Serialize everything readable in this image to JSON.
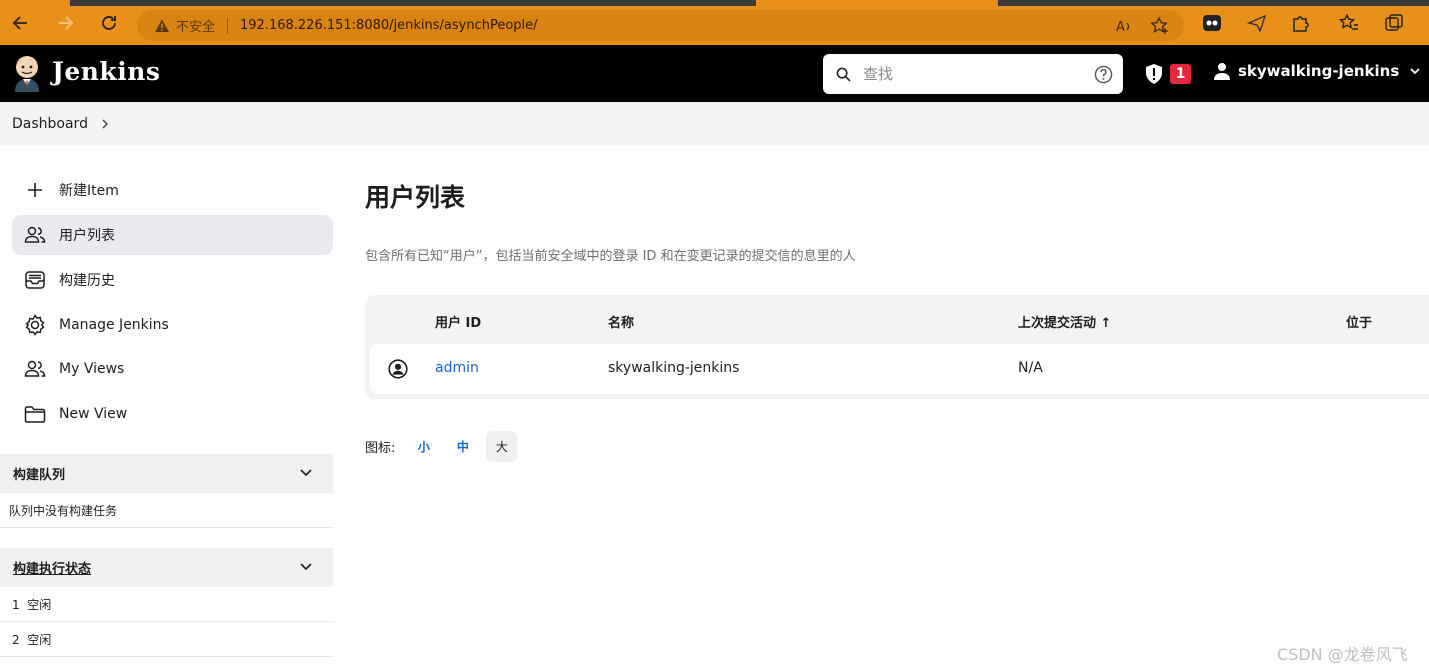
{
  "browser": {
    "security_label": "不安全",
    "url": "192.168.226.151:8080/jenkins/asynchPeople/"
  },
  "header": {
    "brand": "Jenkins",
    "search_placeholder": "查找",
    "alert_count": "1",
    "username": "skywalking-jenkins"
  },
  "breadcrumb": {
    "root": "Dashboard"
  },
  "sidebar": {
    "items": [
      {
        "label": "新建Item",
        "icon": "plus-icon"
      },
      {
        "label": "用户列表",
        "icon": "people-icon",
        "active": true
      },
      {
        "label": "构建历史",
        "icon": "history-icon"
      },
      {
        "label": "Manage Jenkins",
        "icon": "gear-icon"
      },
      {
        "label": "My Views",
        "icon": "people-icon"
      },
      {
        "label": "New View",
        "icon": "folder-icon"
      }
    ],
    "queue": {
      "title": "构建队列",
      "empty_text": "队列中没有构建任务"
    },
    "executors": {
      "title": "构建执行状态",
      "rows": [
        "1  空闲",
        "2  空闲"
      ]
    }
  },
  "main": {
    "title": "用户列表",
    "description": "包含所有已知“用户”，包括当前安全域中的登录 ID 和在变更记录的提交信的息里的人",
    "columns": {
      "user_id": "用户 ID",
      "name": "名称",
      "last_commit": "上次提交活动 ↑",
      "on": "位于"
    },
    "rows": [
      {
        "user_id": "admin",
        "name": "skywalking-jenkins",
        "last_commit": "N/A",
        "on": ""
      }
    ],
    "icon_size": {
      "label": "图标:",
      "small": "小",
      "medium": "中",
      "large": "大"
    }
  },
  "watermark": "CSDN @龙卷风飞"
}
